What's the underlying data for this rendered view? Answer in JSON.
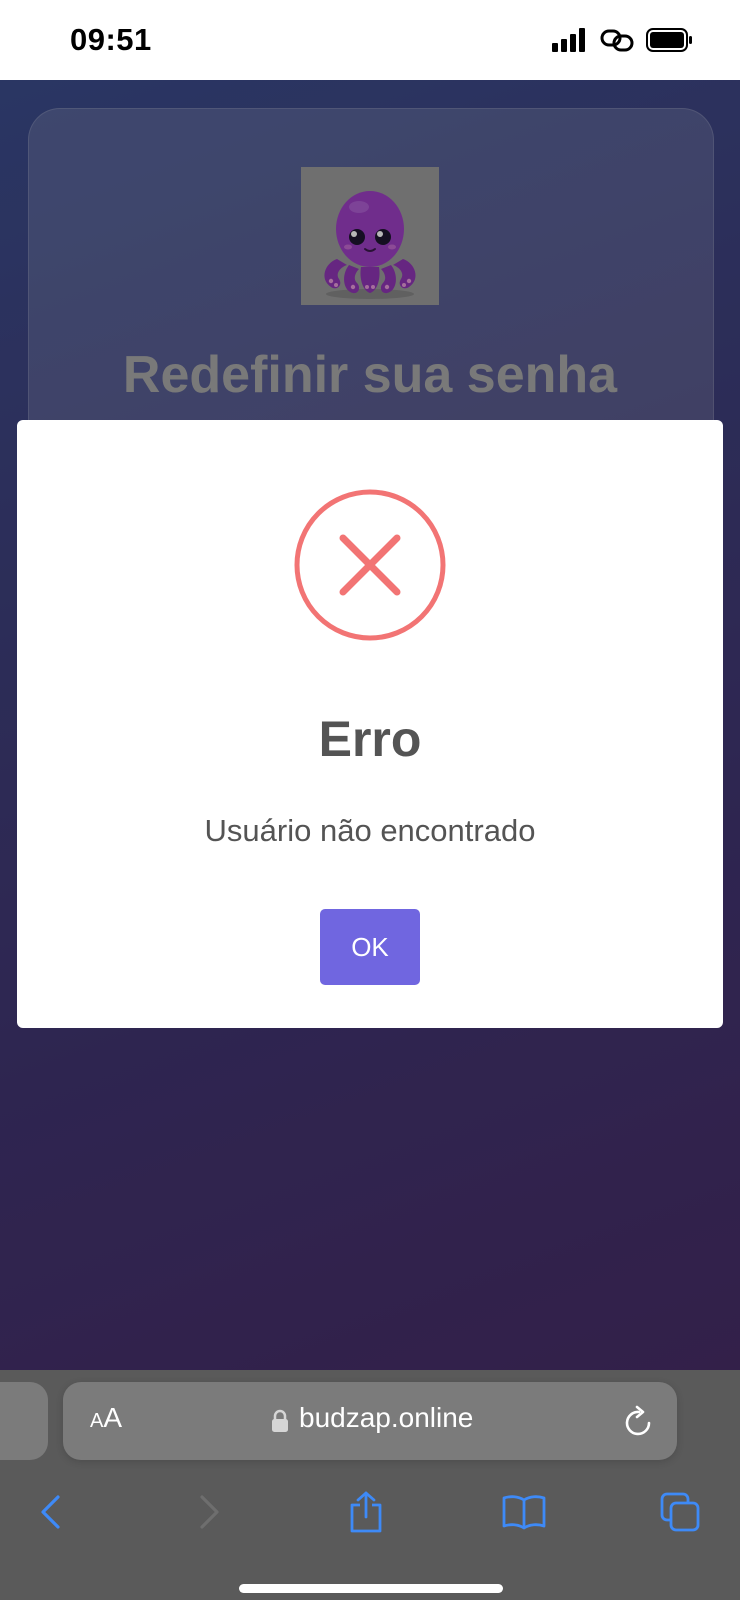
{
  "status_bar": {
    "time": "09:51",
    "icons": [
      "signal-bars-icon",
      "link-icon",
      "battery-icon"
    ]
  },
  "page": {
    "title": "Redefinir sua senha",
    "logo": "octopus-mascot-logo",
    "background_colors": [
      "#3b4b8a",
      "#472d66"
    ]
  },
  "modal": {
    "icon": "error-x-icon",
    "icon_color": "#f27474",
    "title": "Erro",
    "message": "Usuário não encontrado",
    "ok_label": "OK",
    "ok_color": "#7066e0"
  },
  "browser": {
    "text_size_label_small": "A",
    "text_size_label_large": "A",
    "url": "budzap.online",
    "icons": [
      "lock-icon",
      "reload-icon",
      "back-icon",
      "forward-icon",
      "share-icon",
      "bookmarks-icon",
      "tabs-icon"
    ],
    "accent_color": "#3e8af7"
  }
}
